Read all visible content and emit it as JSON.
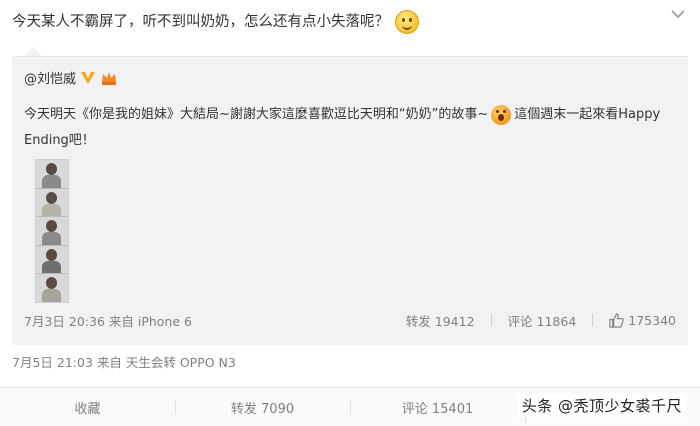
{
  "post": {
    "text": "今天某人不霸屏了，听不到叫奶奶，怎么还有点小失落呢？",
    "emoji": "smile-emoji"
  },
  "repost": {
    "author": "@刘恺威",
    "text": "今天明天《你是我的姐妹》大結局~謝謝大家這麼喜歡逗比天明和“奶奶”的故事~",
    "text_after_emoji": "這個週末一起來看Happy Ending吧！",
    "time_source": "7月3日 20:36 来自 iPhone 6",
    "forward": "转发 19412",
    "comment": "评论 11864",
    "likes": "175340"
  },
  "meta": {
    "time_source": "7月5日 21:03 来自 天生会转 OPPO N3"
  },
  "actions": {
    "favorite": "收藏",
    "forward": "转发 7090",
    "comment": "评论 15401"
  },
  "watermark": "头条 @秃顶少女裘千尺",
  "colors": {
    "repost_bg": "#f2f2f5",
    "meta_text": "#808080",
    "verified_badge": "#f5a623"
  }
}
